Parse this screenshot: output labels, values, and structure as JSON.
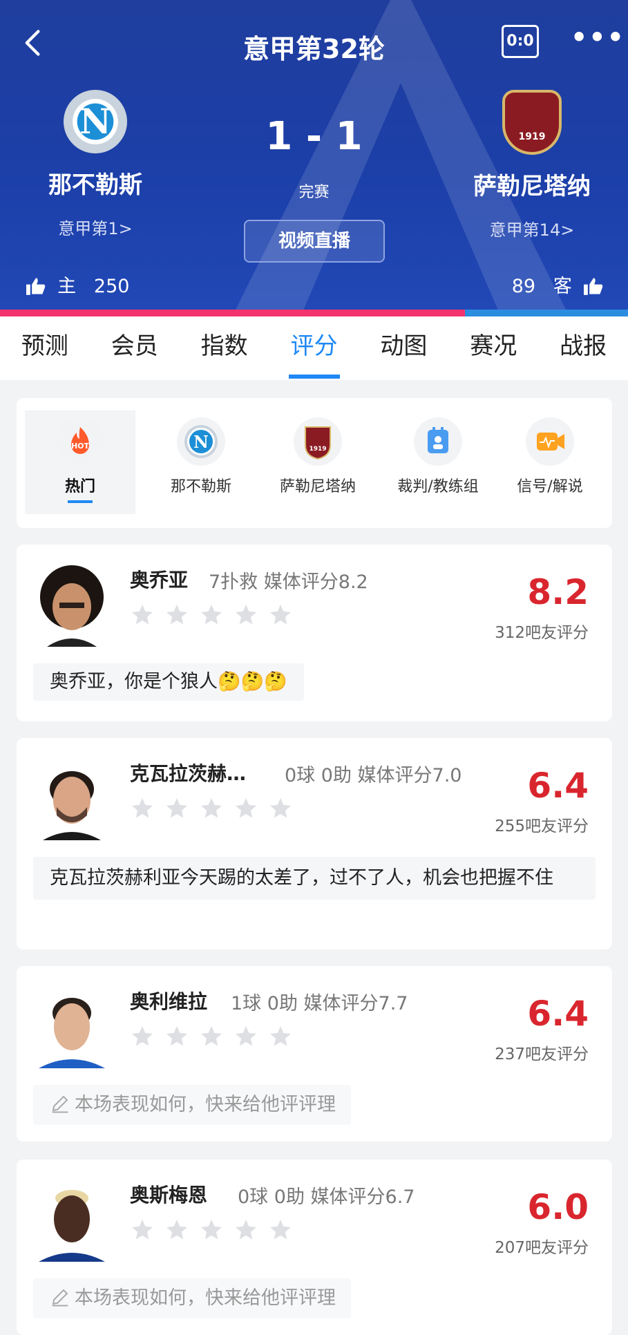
{
  "header": {
    "title": "意甲第32轮",
    "score_icon": "0:0",
    "home": {
      "name": "那不勒斯",
      "rank": "意甲第1>",
      "likes_label": "主",
      "likes": "250",
      "logo_text": "N"
    },
    "away": {
      "name": "萨勒尼塔纳",
      "rank": "意甲第14>",
      "likes_label": "客",
      "likes": "89",
      "logo_text": "1919"
    },
    "score": "1 - 1",
    "status": "完赛",
    "video_button": "视频直播",
    "support_ratio": 0.74,
    "colors": {
      "background": "#1f3e9e",
      "home_bar": "#f4336e",
      "away_bar": "#2b8de0"
    }
  },
  "tabs": [
    {
      "label": "预测"
    },
    {
      "label": "会员"
    },
    {
      "label": "指数"
    },
    {
      "label": "评分",
      "active": true
    },
    {
      "label": "动图"
    },
    {
      "label": "赛况"
    },
    {
      "label": "战报"
    }
  ],
  "filters": [
    {
      "label": "热门",
      "icon": "hot-icon",
      "hot_text": "HOT"
    },
    {
      "label": "那不勒斯",
      "icon": "napoli-logo-icon",
      "logo_text": "N"
    },
    {
      "label": "萨勒尼塔纳",
      "icon": "salernitana-logo-icon",
      "logo_text": "1919"
    },
    {
      "label": "裁判/教练组",
      "icon": "referee-icon"
    },
    {
      "label": "信号/解说",
      "icon": "signal-icon"
    }
  ],
  "players": [
    {
      "name": "奥乔亚",
      "stats": "7扑救  媒体评分8.2",
      "rating": "8.2",
      "fans": "312吧友评分",
      "comment": "奥乔亚，你是个狼人🤔🤔🤔"
    },
    {
      "name": "克瓦拉茨赫…",
      "stats": "0球 0助  媒体评分7.0",
      "rating": "6.4",
      "fans": "255吧友评分",
      "comment": "克瓦拉茨赫利亚今天踢的太差了，过不了人，机会也把握不住"
    },
    {
      "name": "奥利维拉",
      "stats": "1球 0助  媒体评分7.7",
      "rating": "6.4",
      "fans": "237吧友评分",
      "prompt": "本场表现如何，快来给他评评理"
    },
    {
      "name": "奥斯梅恩",
      "stats": "0球 0助  媒体评分6.7",
      "rating": "6.0",
      "fans": "207吧友评分",
      "prompt": "本场表现如何，快来给他评评理"
    }
  ]
}
